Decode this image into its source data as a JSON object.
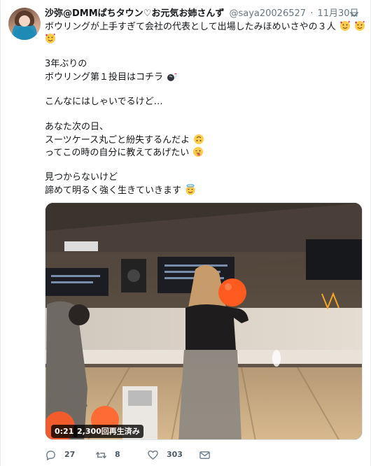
{
  "author": {
    "display_name": "沙弥@DMMぱちタウン♡お元気お姉さんず",
    "handle": "@saya20026527",
    "separator": "·",
    "timestamp": "11月30日"
  },
  "body": {
    "line1": "ボウリングが上手すぎて会社の代表として出場したみほめいさやの３人",
    "line3": "3年ぶりの",
    "line4": "ボウリング第１投目はコチラ",
    "line6": "こんなにはしゃいでるけど…",
    "line8": "あなた次の日、",
    "line9": "スーツケース丸ごと紛失するんだよ",
    "line10": "ってこの時の自分に教えてあげたい",
    "line12": "見つからないけど",
    "line13": "諦めて明るく強く生きていきます"
  },
  "media": {
    "duration": "0:21",
    "views": "2,300回再生済み"
  },
  "actions": {
    "reply_count": "27",
    "retweet_count": "8",
    "like_count": "303"
  },
  "icons": {
    "caret": "chevron-down-icon",
    "reply": "reply-icon",
    "retweet": "retweet-icon",
    "like": "heart-icon",
    "dm": "direct-message-icon",
    "emoji_love": "smiling-face-with-hearts-emoji",
    "emoji_bowling": "bowling-emoji",
    "emoji_upside": "upside-down-face-emoji",
    "emoji_tongue": "winking-face-with-tongue-emoji",
    "emoji_halo": "smiling-face-with-halo-emoji"
  },
  "colors": {
    "text": "#14171a",
    "muted": "#657786",
    "border": "#e6ecf0"
  }
}
